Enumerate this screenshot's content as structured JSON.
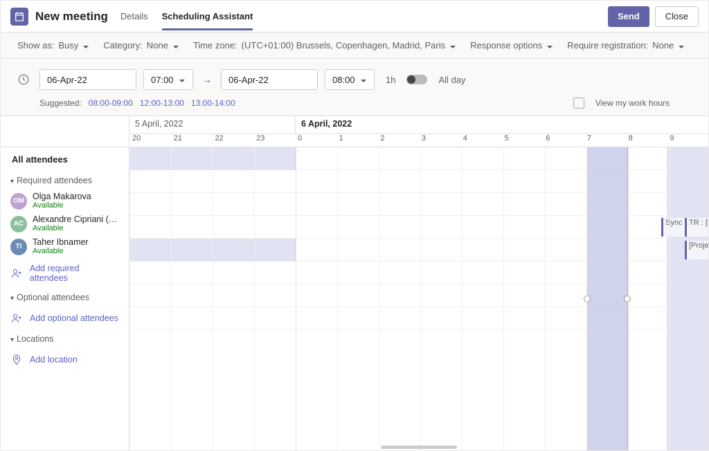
{
  "header": {
    "title": "New meeting",
    "tabs": [
      "Details",
      "Scheduling Assistant"
    ],
    "active_tab": 1,
    "send": "Send",
    "close": "Close"
  },
  "options": {
    "show_as_label": "Show as:",
    "show_as_value": "Busy",
    "category_label": "Category:",
    "category_value": "None",
    "timezone_label": "Time zone:",
    "timezone_value": "(UTC+01:00) Brussels, Copenhagen, Madrid, Paris",
    "response_label": "Response options",
    "registration_label": "Require registration:",
    "registration_value": "None"
  },
  "datetime": {
    "start_date": "06-Apr-22",
    "start_time": "07:00",
    "end_date": "06-Apr-22",
    "end_time": "08:00",
    "duration": "1h",
    "all_day": "All day"
  },
  "suggested": {
    "label": "Suggested:",
    "slots": [
      "08:00-09:00",
      "12:00-13:00",
      "13:00-14:00"
    ],
    "view_hours": "View my work hours"
  },
  "timeline": {
    "day1_label": "5 April, 2022",
    "day2_label": "6 April, 2022",
    "day1_hours": [
      "20",
      "21",
      "22",
      "23"
    ],
    "day2_hours": [
      "0",
      "1",
      "2",
      "3",
      "4",
      "5",
      "6",
      "7",
      "8",
      "9"
    ],
    "selection_start_hour": 7,
    "selection_end_hour": 8
  },
  "attendees": {
    "all_label": "All attendees",
    "required_label": "Required attendees",
    "optional_label": "Optional attendees",
    "locations_label": "Locations",
    "add_required": "Add required attendees",
    "add_optional": "Add optional attendees",
    "add_location": "Add location",
    "required": [
      {
        "name": "Olga Makarova",
        "status": "Available",
        "initials": "OM"
      },
      {
        "name": "Alexandre Cipriani (nB…",
        "status": "Available",
        "initials": "AC"
      },
      {
        "name": "Taher Ibnamer",
        "status": "Available",
        "initials": "TI"
      }
    ]
  },
  "events": {
    "sync": "Sync l",
    "tr": "TR : [Pr",
    "projet": "[Projet"
  }
}
